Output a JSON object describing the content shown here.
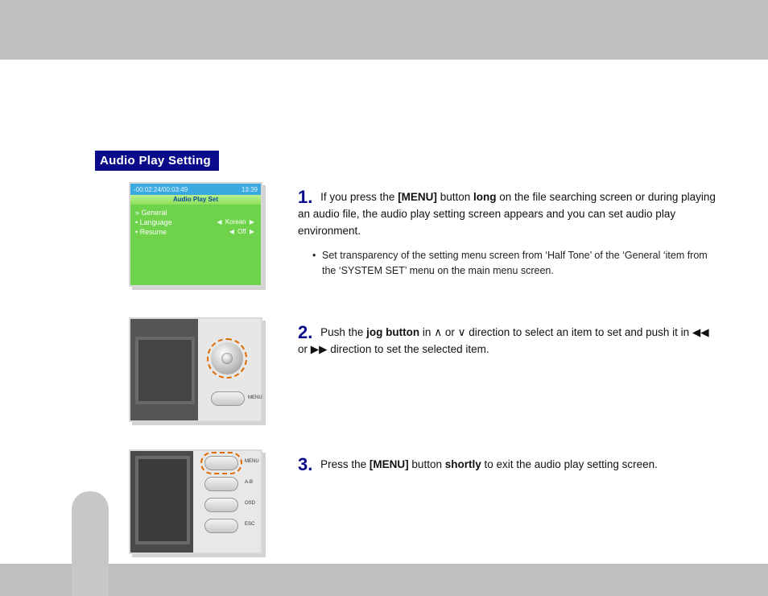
{
  "section_title": "Audio Play Setting",
  "screen1": {
    "status_left": "-00:02:24/00:03:49",
    "status_right": "13:39",
    "title": "Audio Play Set",
    "rows": [
      {
        "left": "» General",
        "mid": "",
        "right": ""
      },
      {
        "left": "  • Language",
        "mid": "◀",
        "right": "Korean",
        "mid2": "▶"
      },
      {
        "left": "  • Resume",
        "mid": "◀",
        "right": "Off",
        "mid2": "▶"
      }
    ]
  },
  "screen2": {
    "menu_label": "MENU"
  },
  "screen3": {
    "buttons": [
      "MENU",
      "A-B",
      "OSD",
      "ESC"
    ]
  },
  "steps": {
    "s1": {
      "num": "1.",
      "pre": "If you press the ",
      "menu": "[MENU]",
      "mid1": " button ",
      "long": "long",
      "post": " on the file searching screen or during playing an audio file, the audio play setting screen appears and you can set audio play environment.",
      "sub": "Set transparency of the setting menu screen from ‘Half Tone’ of the ‘General ‘item from the ‘SYSTEM SET’ menu on the main menu screen."
    },
    "s2": {
      "num": "2.",
      "pre": "Push the ",
      "jog": "jog button",
      "mid1": " in ",
      "up": "∧",
      "or1": " or ",
      "down": "∨",
      "mid2": " direction to select an item to set and push it in  ",
      "rew": "◀◀",
      "or2": "  or  ",
      "fwd": "▶▶",
      "post": "  direction to set the selected item."
    },
    "s3": {
      "num": "3.",
      "pre": "Press the ",
      "menu": "[MENU]",
      "mid1": " button ",
      "short": "shortly",
      "post": " to exit the audio play setting screen."
    }
  }
}
